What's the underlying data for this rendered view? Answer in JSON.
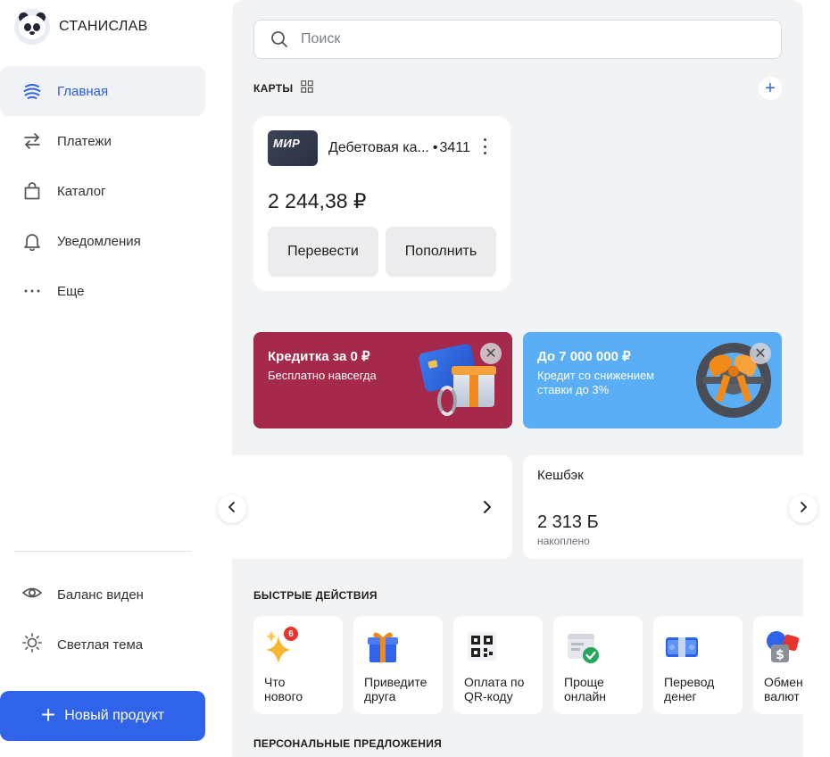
{
  "profile": {
    "name": "СТАНИСЛАВ"
  },
  "nav": {
    "items": [
      {
        "label": "Главная",
        "icon": "home-globe-icon",
        "active": true
      },
      {
        "label": "Платежи",
        "icon": "transfer-arrows-icon",
        "active": false
      },
      {
        "label": "Каталог",
        "icon": "shopping-bag-icon",
        "active": false
      },
      {
        "label": "Уведомления",
        "icon": "bell-icon",
        "active": false
      },
      {
        "label": "Еще",
        "icon": "more-dots-icon",
        "active": false
      }
    ]
  },
  "sidebar_bottom": {
    "balance_toggle": "Баланс виден",
    "theme_toggle": "Светлая тема",
    "new_product": "Новый продукт"
  },
  "search": {
    "placeholder": "Поиск",
    "value": ""
  },
  "cards_section": {
    "title": "КАРТЫ",
    "card": {
      "logo": "МИР",
      "name": "Дебетовая ка...",
      "number": "3411",
      "balance": "2 244,38 ₽",
      "transfer_btn": "Перевести",
      "topup_btn": "Пополнить"
    }
  },
  "promos": [
    {
      "title": "Кредитка за 0 ₽",
      "subtitle": "Бесплатно навсегда",
      "color": "#a5294a",
      "visual": "card-with-gift-illustration"
    },
    {
      "title": "До 7 000 000 ₽",
      "subtitle": "Кредит со снижением ставки до 3%",
      "color": "#5aaef5",
      "visual": "steering-wheel-gift-illustration"
    }
  ],
  "cashback": {
    "title": "Кешбэк",
    "amount": "2 313 Б",
    "caption": "накоплено"
  },
  "quick_actions": {
    "title": "БЫСТРЫЕ ДЕЙСТВИЯ",
    "items": [
      {
        "label": "Что\nнового",
        "icon": "sparkles-icon",
        "badge": "6"
      },
      {
        "label": "Приведите\nдруга",
        "icon": "gift-icon"
      },
      {
        "label": "Оплата по\nQR-коду",
        "icon": "qr-code-icon"
      },
      {
        "label": "Проще\nонлайн",
        "icon": "document-check-icon"
      },
      {
        "label": "Перевод\nденег",
        "icon": "money-stack-icon"
      },
      {
        "label": "Обмен\nвалют",
        "icon": "currency-exchange-icon"
      }
    ]
  },
  "personal_offers": {
    "title": "ПЕРСОНАЛЬНЫЕ ПРЕДЛОЖЕНИЯ"
  },
  "colors": {
    "accent": "#2f63ea",
    "background": "#f2f3f5"
  }
}
